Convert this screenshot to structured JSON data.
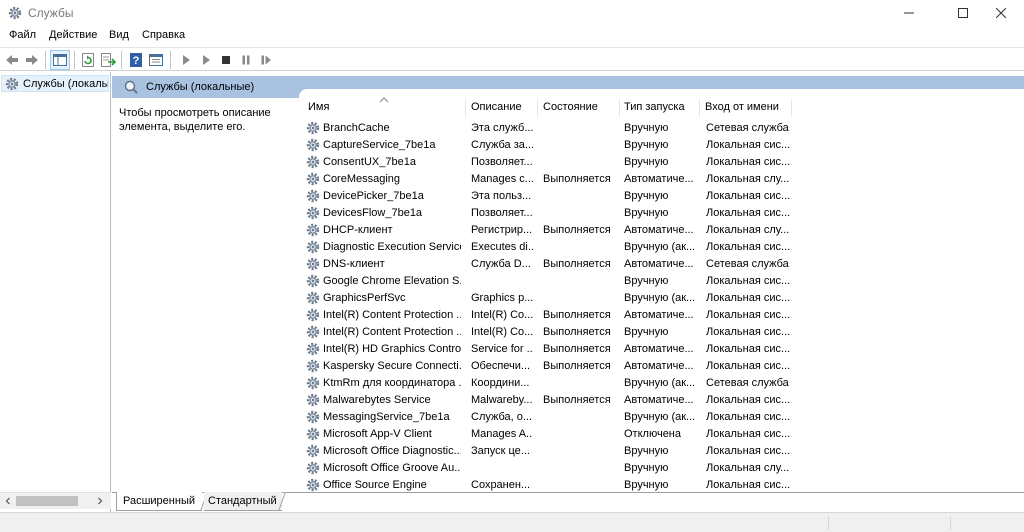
{
  "window": {
    "title": "Службы",
    "icon": "services-gear-icon"
  },
  "menu": {
    "items": [
      "Файл",
      "Действие",
      "Вид",
      "Справка"
    ]
  },
  "toolbar": {
    "buttons": [
      "back-arrow-icon",
      "forward-arrow-icon",
      "console-tree-icon",
      "refresh-icon",
      "export-list-icon",
      "help-icon",
      "properties-icon",
      "start-service-icon",
      "start-service-alt-icon",
      "stop-service-icon",
      "pause-service-icon",
      "restart-service-icon"
    ]
  },
  "tree": {
    "selected_label": "Службы (локалы"
  },
  "pane": {
    "header": "Службы (локальные)",
    "description_hint": "Чтобы просмотреть описание элемента, выделите его."
  },
  "columns": {
    "name": "Имя",
    "description": "Описание",
    "status": "Состояние",
    "startup": "Тип запуска",
    "logon": "Вход от имени"
  },
  "services": [
    {
      "name": "BranchCache",
      "description": "Эта служб...",
      "status": "",
      "startup": "Вручную",
      "logon": "Сетевая служба"
    },
    {
      "name": "CaptureService_7be1a",
      "description": "Служба за...",
      "status": "",
      "startup": "Вручную",
      "logon": "Локальная сис..."
    },
    {
      "name": "ConsentUX_7be1a",
      "description": "Позволяет...",
      "status": "",
      "startup": "Вручную",
      "logon": "Локальная сис..."
    },
    {
      "name": "CoreMessaging",
      "description": "Manages c...",
      "status": "Выполняется",
      "startup": "Автоматиче...",
      "logon": "Локальная слу..."
    },
    {
      "name": "DevicePicker_7be1a",
      "description": "Эта польз...",
      "status": "",
      "startup": "Вручную",
      "logon": "Локальная сис..."
    },
    {
      "name": "DevicesFlow_7be1a",
      "description": "Позволяет...",
      "status": "",
      "startup": "Вручную",
      "logon": "Локальная сис..."
    },
    {
      "name": "DHCP-клиент",
      "description": "Регистрир...",
      "status": "Выполняется",
      "startup": "Автоматиче...",
      "logon": "Локальная слу..."
    },
    {
      "name": "Diagnostic Execution Service",
      "description": "Executes di...",
      "status": "",
      "startup": "Вручную (ак...",
      "logon": "Локальная сис..."
    },
    {
      "name": "DNS-клиент",
      "description": "Служба D...",
      "status": "Выполняется",
      "startup": "Автоматиче...",
      "logon": "Сетевая служба"
    },
    {
      "name": "Google Chrome Elevation S...",
      "description": "",
      "status": "",
      "startup": "Вручную",
      "logon": "Локальная сис..."
    },
    {
      "name": "GraphicsPerfSvc",
      "description": "Graphics p...",
      "status": "",
      "startup": "Вручную (ак...",
      "logon": "Локальная сис..."
    },
    {
      "name": "Intel(R) Content Protection ...",
      "description": "Intel(R) Co...",
      "status": "Выполняется",
      "startup": "Автоматиче...",
      "logon": "Локальная сис..."
    },
    {
      "name": "Intel(R) Content Protection ...",
      "description": "Intel(R) Co...",
      "status": "Выполняется",
      "startup": "Вручную",
      "logon": "Локальная сис..."
    },
    {
      "name": "Intel(R) HD Graphics Contro...",
      "description": "Service for ...",
      "status": "Выполняется",
      "startup": "Автоматиче...",
      "logon": "Локальная сис..."
    },
    {
      "name": "Kaspersky Secure Connecti...",
      "description": "Обеспечи...",
      "status": "Выполняется",
      "startup": "Автоматиче...",
      "logon": "Локальная сис..."
    },
    {
      "name": "KtmRm для координатора ...",
      "description": "Координи...",
      "status": "",
      "startup": "Вручную (ак...",
      "logon": "Сетевая служба"
    },
    {
      "name": "Malwarebytes Service",
      "description": "Malwareby...",
      "status": "Выполняется",
      "startup": "Автоматиче...",
      "logon": "Локальная сис..."
    },
    {
      "name": "MessagingService_7be1a",
      "description": "Служба, о...",
      "status": "",
      "startup": "Вручную (ак...",
      "logon": "Локальная сис..."
    },
    {
      "name": "Microsoft App-V Client",
      "description": "Manages A...",
      "status": "",
      "startup": "Отключена",
      "logon": "Локальная сис..."
    },
    {
      "name": "Microsoft Office Diagnostic...",
      "description": "Запуск це...",
      "status": "",
      "startup": "Вручную",
      "logon": "Локальная сис..."
    },
    {
      "name": "Microsoft Office Groove Au...",
      "description": "",
      "status": "",
      "startup": "Вручную",
      "logon": "Локальная слу..."
    },
    {
      "name": "Office Source Engine",
      "description": "Сохранен...",
      "status": "",
      "startup": "Вручную",
      "logon": "Локальная сис..."
    }
  ],
  "tabs": {
    "extended": "Расширенный",
    "standard": "Стандартный"
  },
  "colors": {
    "header_band": "#a8c2df",
    "tree_selection": "#e5f1fb",
    "help_icon": "#2f5fa8"
  }
}
